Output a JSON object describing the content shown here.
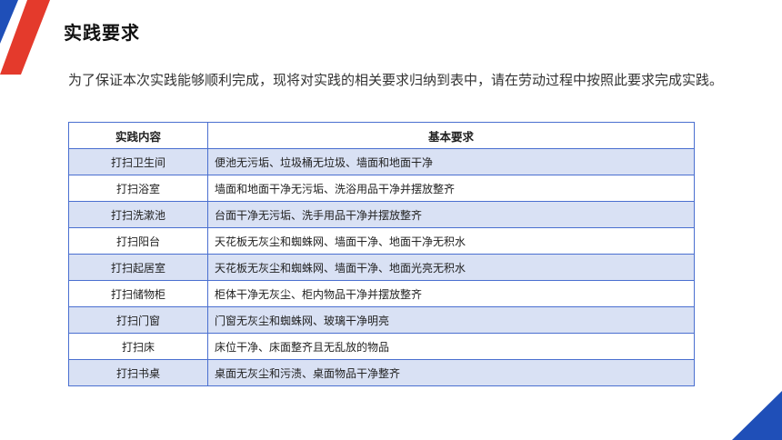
{
  "title": "实践要求",
  "intro": "为了保证本次实践能够顺利完成，现将对实践的相关要求归纳到表中，请在劳动过程中按照此要求完成实践。",
  "table": {
    "headers": [
      "实践内容",
      "基本要求"
    ],
    "rows": [
      {
        "content": "打扫卫生间",
        "requirement": "便池无污垢、垃圾桶无垃圾、墙面和地面干净"
      },
      {
        "content": "打扫浴室",
        "requirement": "墙面和地面干净无污垢、洗浴用品干净并摆放整齐"
      },
      {
        "content": "打扫洗漱池",
        "requirement": "台面干净无污垢、洗手用品干净并摆放整齐"
      },
      {
        "content": "打扫阳台",
        "requirement": "天花板无灰尘和蜘蛛网、墙面干净、地面干净无积水"
      },
      {
        "content": "打扫起居室",
        "requirement": "天花板无灰尘和蜘蛛网、墙面干净、地面光亮无积水"
      },
      {
        "content": "打扫储物柜",
        "requirement": "柜体干净无灰尘、柜内物品干净并摆放整齐"
      },
      {
        "content": "打扫门窗",
        "requirement": "门窗无灰尘和蜘蛛网、玻璃干净明亮"
      },
      {
        "content": "打扫床",
        "requirement": "床位干净、床面整齐且无乱放的物品"
      },
      {
        "content": "打扫书桌",
        "requirement": "桌面无灰尘和污渍、桌面物品干净整齐"
      }
    ]
  },
  "colors": {
    "accent_red": "#e43a2c",
    "accent_blue": "#1f4fb8",
    "border_blue": "#4a6fd0",
    "row_shade": "#d9e1f4"
  }
}
